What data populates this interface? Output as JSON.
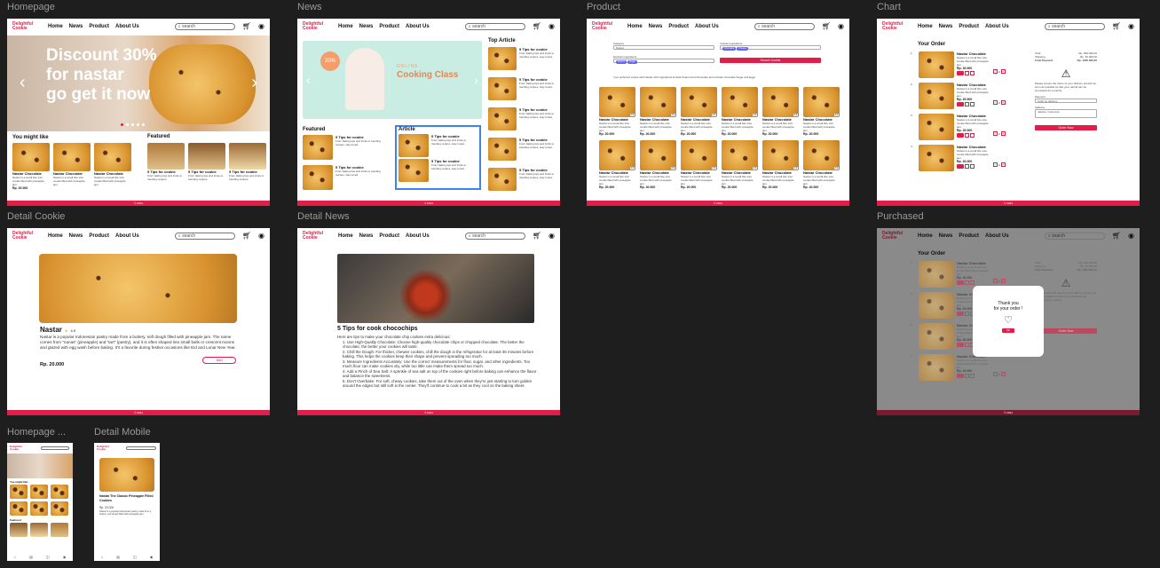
{
  "frames": {
    "homepage": "Homepage",
    "news": "News",
    "product": "Product",
    "chart": "Chart",
    "detail_cookie": "Detail Cookie",
    "detail_news": "Detail News",
    "purchased": "Purchased",
    "homepage_mobile": "Homepage ...",
    "detail_mobile": "Detail Mobile"
  },
  "nav": {
    "logo_line1": "Delightful",
    "logo_line2": "Cookie",
    "links": [
      "Home",
      "News",
      "Product",
      "About Us"
    ],
    "search_placeholder": "search",
    "cart_icon": "cart-icon",
    "profile_icon": "user-icon"
  },
  "footer": "© 2024",
  "homepage": {
    "hero_line1": "Discount 30%",
    "hero_line2": "for nastar",
    "hero_line3": "go get it now",
    "you_might_like": "You might like",
    "featured": "Featured",
    "product_name": "Nastar Chocolate",
    "product_desc": "Nastar is a small bite size cookie filled with pineapple jam.",
    "product_price": "Rp. 20.000",
    "rating": "4.9",
    "featured_title": "5 Tips for cookie",
    "featured_desc": "From baking tips and tricks to trending recipes."
  },
  "news": {
    "banner_top": "20%",
    "banner_kicker": "ONLINE",
    "banner_title": "Cooking Class",
    "top_article": "Top Article",
    "featured": "Featured",
    "article": "Article",
    "item_title": "5 Tips for cookie",
    "item_desc": "From baking tips and tricks to trending recipes, stay tuned."
  },
  "product": {
    "category_label": "Category",
    "category_value": "Nastar",
    "include_label": "Include Ingredients",
    "exclude_label": "Exclude Ingredients",
    "include_chips": [
      "Chocolate",
      "Cheese"
    ],
    "exclude_chips": [
      "Peanut",
      "Sugar"
    ],
    "search_button": "Search Cookie",
    "result_note": "*you preferred cookie with Nastar with ingredients include Peanut and Chocolate and exclude chocolate Sugar and Eggs",
    "card_name": "Nastar Chocolate",
    "card_desc": "Nastar is a small bite size cookie filled with pineapple jam.",
    "card_price": "Rp. 20.000",
    "rating": "4.9"
  },
  "chart": {
    "your_order": "Your Order",
    "item_name": "Nastar Chocolate",
    "item_desc": "Nastar is a small bite size cookie filled with pineapple jam.",
    "item_price": "Rp. 20.000",
    "numbers": [
      "1.",
      "2.",
      "3.",
      "4."
    ],
    "qty": "2",
    "total_label": "Total",
    "total_value": "Rp. 900.000,00",
    "shipping_label": "Shipping",
    "shipping_value": "Rp. 40.000,00",
    "total_payment_label": "Total Payment",
    "total_payment_value": "Rp. 1000.000,00",
    "warning": "Please ensure the return of your delivery product as soon as possible so that your refund can be processed as a priority.",
    "payment_label": "Payment",
    "payment_value": "Cash on delivery",
    "address_label": "Address",
    "address_value": "Jakarta, Indonesia",
    "order_button": "Order Now"
  },
  "detail_cookie": {
    "title": "Nastar",
    "rating": "4.9",
    "desc": "Nastar is a popular Indonesian pastry made from a buttery, soft dough filled with pineapple jam. The name comes from \"nanas\" (pineapple) and \"tart\" (pastry), and it is often shaped into small balls or crescent moons and glazed with egg wash before baking. It's a favorite during festive occasions like Eid and Lunar New Year.",
    "price": "Rp. 20.000",
    "add_button": "Add"
  },
  "detail_news": {
    "title": "5 Tips for cook chocochips",
    "intro": "Here are tips to make your chocolate chip cookies extra delicious:",
    "items": [
      "1. Use High-Quality Chocolate: Choose high-quality chocolate chips or chopped chocolate. The better the chocolate, the better your cookies will taste.",
      "2. Chill the Dough: For thicker, chewier cookies, chill the dough in the refrigerator for at least 30 minutes before baking. This helps the cookies keep their shape and prevent spreading too much.",
      "3. Measure Ingredients Accurately: Use the correct measurements for flour, sugar, and other ingredients. Too much flour can make cookies dry, while too little can make them spread too much.",
      "4. Add a Pinch of Sea Salt: A sprinkle of sea salt on top of the cookies right before baking can enhance the flavor and balance the sweetness.",
      "5. Don't Overbake: For soft, chewy cookies, take them out of the oven when they're just starting to turn golden around the edges but still soft in the center. They'll continue to cook a bit as they cool on the baking sheet."
    ]
  },
  "purchased": {
    "modal_line1": "Thank you",
    "modal_line2": "for your order !",
    "ok": "Ok"
  },
  "mobile": {
    "you_might_like": "You might like",
    "featured": "Featured",
    "detail_title": "Nastar The Classic Pineapple Filled Cookies",
    "detail_price": "Rp. 20.000",
    "detail_desc": "Nastar is a popular Indonesian pastry made from a buttery, soft dough filled with pineapple jam."
  }
}
